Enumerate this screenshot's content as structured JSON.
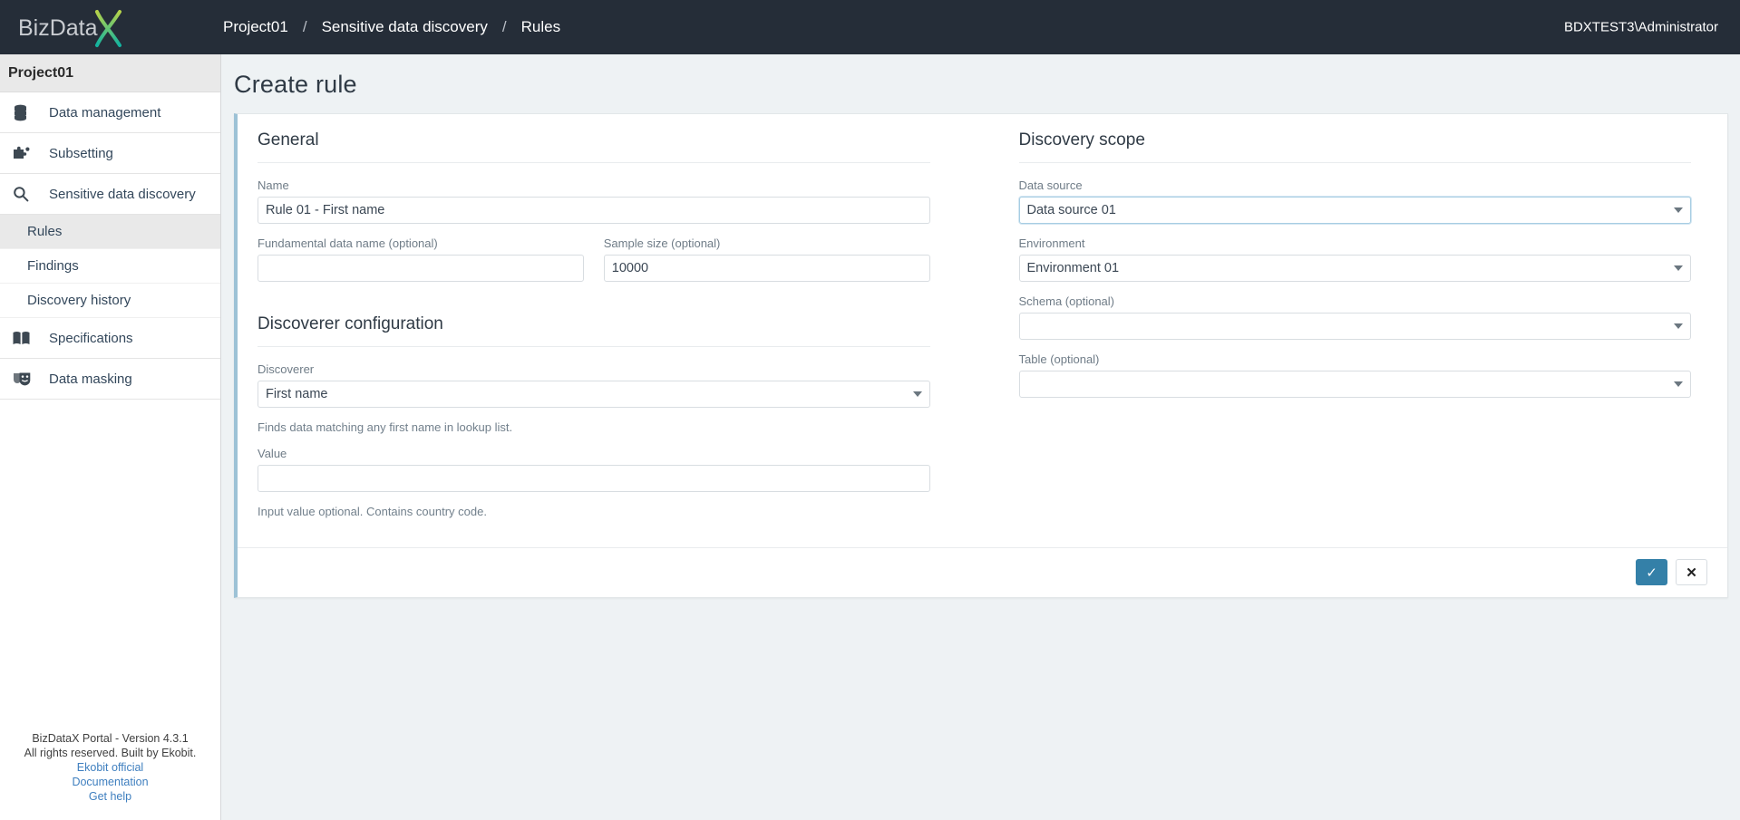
{
  "topbar": {
    "logo_text_part1": "BizData",
    "logo_text_part2": "X",
    "breadcrumb": [
      {
        "label": "Project01"
      },
      {
        "label": "Sensitive data discovery"
      },
      {
        "label": "Rules"
      }
    ],
    "breadcrumb_separator": "/",
    "user": "BDXTEST3\\Administrator"
  },
  "sidebar": {
    "project": "Project01",
    "items": [
      {
        "label": "Data management",
        "icon": "database-icon"
      },
      {
        "label": "Subsetting",
        "icon": "puzzle-icon"
      },
      {
        "label": "Sensitive data discovery",
        "icon": "search-icon"
      }
    ],
    "subitems": [
      {
        "label": "Rules",
        "active": true
      },
      {
        "label": "Findings",
        "active": false
      },
      {
        "label": "Discovery history",
        "active": false
      }
    ],
    "items_bottom": [
      {
        "label": "Specifications",
        "icon": "book-icon"
      },
      {
        "label": "Data masking",
        "icon": "masks-icon"
      }
    ],
    "footer": {
      "version": "BizDataX Portal - Version 4.3.1",
      "rights": "All rights reserved. Built by Ekobit.",
      "links": [
        {
          "label": "Ekobit official"
        },
        {
          "label": "Documentation"
        },
        {
          "label": "Get help"
        }
      ]
    }
  },
  "main": {
    "page_title": "Create rule",
    "general": {
      "section_title": "General",
      "name": {
        "label": "Name",
        "value": "Rule 01 - First name",
        "placeholder": ""
      },
      "fundamental_data_name": {
        "label": "Fundamental data name (optional)",
        "value": "",
        "placeholder": ""
      },
      "sample_size": {
        "label": "Sample size (optional)",
        "value": "10000",
        "placeholder": ""
      }
    },
    "discoverer_configuration": {
      "section_title": "Discoverer configuration",
      "discoverer": {
        "label": "Discoverer",
        "value": "First name"
      },
      "discoverer_help": "Finds data matching any first name in lookup list.",
      "value_field": {
        "label": "Value",
        "value": "",
        "placeholder": ""
      },
      "value_help": "Input value optional. Contains country code."
    },
    "discovery_scope": {
      "section_title": "Discovery scope",
      "data_source": {
        "label": "Data source",
        "value": "Data source 01"
      },
      "environment": {
        "label": "Environment",
        "value": "Environment 01"
      },
      "schema": {
        "label": "Schema (optional)",
        "value": ""
      },
      "table": {
        "label": "Table (optional)",
        "value": ""
      }
    },
    "actions": {
      "confirm_label": "✓",
      "cancel_label": "✕"
    }
  },
  "colors": {
    "topbar_bg": "#252d38",
    "accent_blue": "#3480a8",
    "card_accent": "#9dc2d6",
    "page_bg": "#eef2f4",
    "logo_teal": "#1fbfa4",
    "logo_green": "#a8d24a"
  }
}
